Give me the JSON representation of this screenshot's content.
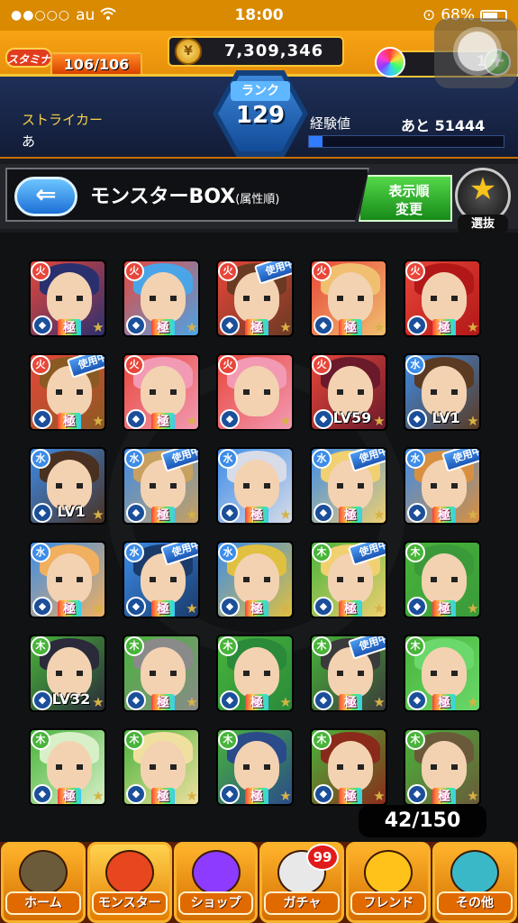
{
  "status_bar": {
    "carrier": "au",
    "signal_dots": "●●○○○",
    "time": "18:00",
    "battery": "68%"
  },
  "header": {
    "stamina_label": "スタミナ",
    "stamina_value": "106/106",
    "stamina_fraction": 1.0,
    "gold_icon": "coin-icon",
    "gold": "7,309,346",
    "orbs": "1",
    "orb_plus": "+",
    "rank_label": "ランク",
    "rank": "129",
    "player_type": "ストライカー",
    "player_name": "あ",
    "exp_label": "経験値",
    "exp_remaining": "あと 51444",
    "exp_fraction": 0.07
  },
  "box": {
    "back_label": "⇐",
    "title": "モンスターBOX",
    "sort_hint": "(属性順)",
    "sort_button": "表示順\n変更",
    "select_label": "選抜",
    "count": "42/150"
  },
  "monsters": [
    {
      "colors": [
        "#e8463a",
        "#2a2f6e"
      ],
      "element": "fire",
      "label": "極",
      "in_use": false,
      "level": ""
    },
    {
      "colors": [
        "#e8463a",
        "#4aa5e8"
      ],
      "element": "fire",
      "label": "極",
      "in_use": false,
      "level": ""
    },
    {
      "colors": [
        "#e8463a",
        "#6a3a22"
      ],
      "element": "fire",
      "label": "極",
      "in_use": true,
      "level": ""
    },
    {
      "colors": [
        "#e8463a",
        "#f0c070"
      ],
      "element": "fire",
      "label": "極",
      "in_use": false,
      "level": ""
    },
    {
      "colors": [
        "#e8463a",
        "#b21818"
      ],
      "element": "fire",
      "label": "極",
      "in_use": false,
      "level": ""
    },
    {
      "colors": [
        "#e8463a",
        "#8a5a22"
      ],
      "element": "fire",
      "label": "極",
      "in_use": true,
      "level": ""
    },
    {
      "colors": [
        "#e8463a",
        "#f29ab4"
      ],
      "element": "fire",
      "label": "極",
      "in_use": false,
      "level": ""
    },
    {
      "colors": [
        "#e8463a",
        "#f29ab4"
      ],
      "element": "fire",
      "label": "",
      "in_use": false,
      "level": ""
    },
    {
      "colors": [
        "#e8463a",
        "#6a1a2a"
      ],
      "element": "fire",
      "label": "",
      "in_use": false,
      "level": "LV59"
    },
    {
      "colors": [
        "#3c8ce8",
        "#5a3a22"
      ],
      "element": "water",
      "label": "",
      "in_use": false,
      "level": "LV1"
    },
    {
      "colors": [
        "#3c8ce8",
        "#4a3020"
      ],
      "element": "water",
      "label": "",
      "in_use": false,
      "level": "LV1"
    },
    {
      "colors": [
        "#3c8ce8",
        "#c8a060"
      ],
      "element": "water",
      "label": "極",
      "in_use": true,
      "level": ""
    },
    {
      "colors": [
        "#3c8ce8",
        "#d8dce8"
      ],
      "element": "water",
      "label": "極",
      "in_use": false,
      "level": ""
    },
    {
      "colors": [
        "#3c8ce8",
        "#f0d070"
      ],
      "element": "water",
      "label": "極",
      "in_use": true,
      "level": ""
    },
    {
      "colors": [
        "#3c8ce8",
        "#d89040"
      ],
      "element": "water",
      "label": "極",
      "in_use": true,
      "level": ""
    },
    {
      "colors": [
        "#3c8ce8",
        "#f0b060"
      ],
      "element": "water",
      "label": "極",
      "in_use": false,
      "level": ""
    },
    {
      "colors": [
        "#3c8ce8",
        "#1a3a6a"
      ],
      "element": "water",
      "label": "極",
      "in_use": true,
      "level": ""
    },
    {
      "colors": [
        "#3c8ce8",
        "#e0c040"
      ],
      "element": "water",
      "label": "極",
      "in_use": false,
      "level": ""
    },
    {
      "colors": [
        "#48b43a",
        "#f0d070"
      ],
      "element": "wood",
      "label": "極",
      "in_use": true,
      "level": ""
    },
    {
      "colors": [
        "#48b43a",
        "#3a9a3a"
      ],
      "element": "wood",
      "label": "極",
      "in_use": false,
      "level": ""
    },
    {
      "colors": [
        "#48b43a",
        "#2a2a3a"
      ],
      "element": "wood",
      "label": "",
      "in_use": false,
      "level": "LV32"
    },
    {
      "colors": [
        "#48b43a",
        "#8a8a8a"
      ],
      "element": "wood",
      "label": "極",
      "in_use": false,
      "level": ""
    },
    {
      "colors": [
        "#48b43a",
        "#2a8a3a"
      ],
      "element": "wood",
      "label": "極",
      "in_use": false,
      "level": ""
    },
    {
      "colors": [
        "#48b43a",
        "#3a3a3a"
      ],
      "element": "wood",
      "label": "極",
      "in_use": true,
      "level": ""
    },
    {
      "colors": [
        "#48b43a",
        "#6ad86a"
      ],
      "element": "wood",
      "label": "極",
      "in_use": false,
      "level": ""
    },
    {
      "colors": [
        "#48b43a",
        "#d8f0c8"
      ],
      "element": "wood",
      "label": "極",
      "in_use": false,
      "level": ""
    },
    {
      "colors": [
        "#48b43a",
        "#f0e0a0"
      ],
      "element": "wood",
      "label": "極",
      "in_use": false,
      "level": ""
    },
    {
      "colors": [
        "#48b43a",
        "#2a4a8a"
      ],
      "element": "wood",
      "label": "極",
      "in_use": false,
      "level": ""
    },
    {
      "colors": [
        "#48b43a",
        "#8a2a1a"
      ],
      "element": "wood",
      "label": "極",
      "in_use": false,
      "level": ""
    },
    {
      "colors": [
        "#48b43a",
        "#6a5a3a"
      ],
      "element": "wood",
      "label": "極",
      "in_use": false,
      "level": ""
    }
  ],
  "in_use_text": "使用中",
  "nav": [
    {
      "label": "ホーム",
      "icon": "home-icon",
      "color": "#6b5b3a"
    },
    {
      "label": "モンスター",
      "icon": "monster-icon",
      "color": "#e8461e"
    },
    {
      "label": "ショップ",
      "icon": "shop-orb-icon",
      "color": "#8c3bff"
    },
    {
      "label": "ガチャ",
      "icon": "gacha-egg-icon",
      "color": "#e8e8e8"
    },
    {
      "label": "フレンド",
      "icon": "friend-balloon-icon",
      "color": "#ffc21b"
    },
    {
      "label": "その他",
      "icon": "other-icon",
      "color": "#3bb8c8"
    }
  ],
  "gacha_badge": "99"
}
